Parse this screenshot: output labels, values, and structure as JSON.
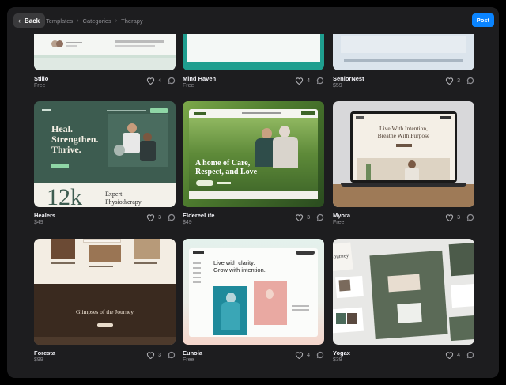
{
  "topbar": {
    "back_label": "Back",
    "breadcrumb": [
      "Templates",
      "Categories",
      "Therapy"
    ],
    "post_label": "Post"
  },
  "icons": {
    "back": "chevron-left-icon",
    "separator": "chevron-right-icon",
    "like": "heart-icon",
    "comment": "comment-icon"
  },
  "cards": [
    {
      "name": "Stillo",
      "price": "Free",
      "likes": "4"
    },
    {
      "name": "Mind Haven",
      "price": "Free",
      "likes": "4"
    },
    {
      "name": "SeniorNest",
      "price": "$59",
      "likes": "3"
    },
    {
      "name": "Healers",
      "price": "$49",
      "likes": "3"
    },
    {
      "name": "EldereeLife",
      "price": "$49",
      "likes": "3"
    },
    {
      "name": "Myora",
      "price": "Free",
      "likes": "3"
    },
    {
      "name": "Foresta",
      "price": "$99",
      "likes": "3"
    },
    {
      "name": "Eunoia",
      "price": "Free",
      "likes": "4"
    },
    {
      "name": "Yogax",
      "price": "$39",
      "likes": "4"
    }
  ],
  "previews": {
    "healers_headline": [
      "Heal.",
      "Strengthen.",
      "Thrive."
    ],
    "healers_stat": "12k",
    "healers_subhead": [
      "Expert",
      "Physiotherapy"
    ],
    "elderee_headline": [
      "A home of Care,",
      "Respect, and Love"
    ],
    "myora_headline": [
      "Live With Intention,",
      "Breathe With Purpose"
    ],
    "foresta_headline": "Glimpses of the Journey",
    "eunoia_headline": [
      "Live with clarity.",
      "Grow with intention."
    ],
    "yogax_headline": "Journey"
  },
  "colors": {
    "accent": "#0a84ff",
    "background": "#1d1d1f"
  }
}
